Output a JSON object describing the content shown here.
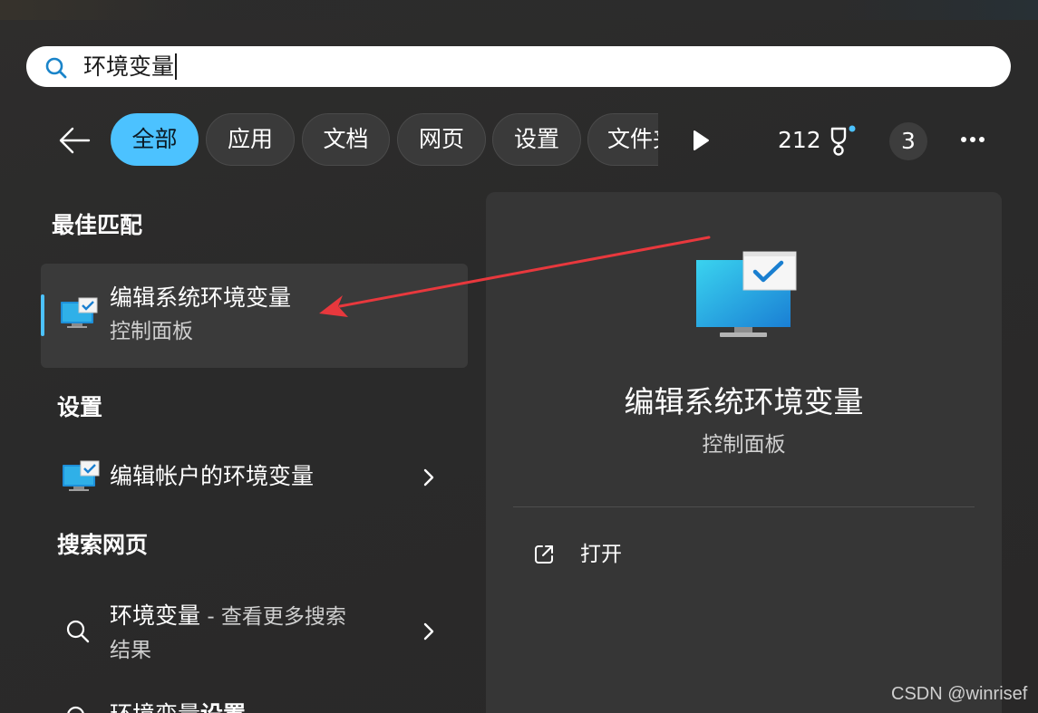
{
  "search": {
    "query": "环境变量"
  },
  "filters": {
    "chips": [
      {
        "label": "全部",
        "active": true
      },
      {
        "label": "应用",
        "active": false
      },
      {
        "label": "文档",
        "active": false
      },
      {
        "label": "网页",
        "active": false
      },
      {
        "label": "设置",
        "active": false
      },
      {
        "label": "文件夹",
        "active": false
      }
    ],
    "points": "212",
    "badge_count": "3"
  },
  "results": {
    "best_match_header": "最佳匹配",
    "best_match": {
      "title": "编辑系统环境变量",
      "subtitle": "控制面板"
    },
    "settings_header": "设置",
    "settings_item": {
      "title": "编辑帐户的环境变量"
    },
    "web_header": "搜索网页",
    "web_item": {
      "title": "环境变量",
      "suffix": " - 查看更多搜索",
      "subtitle": "结果"
    },
    "web_item_partial": {
      "title": "环境变量",
      "suffix": "设置"
    }
  },
  "preview": {
    "title": "编辑系统环境变量",
    "subtitle": "控制面板",
    "actions": [
      {
        "label": "打开",
        "icon": "open-external-icon"
      }
    ]
  },
  "watermark": "CSDN @winrisef",
  "colors": {
    "accent": "#4cc2ff",
    "annotation_arrow": "#e8383d",
    "panel": "#363636",
    "background": "#2b2b2b"
  }
}
